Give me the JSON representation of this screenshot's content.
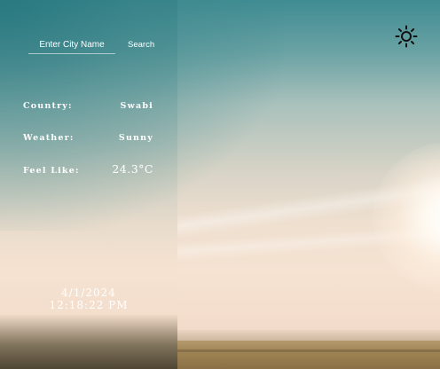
{
  "search": {
    "placeholder": "Enter City Name",
    "value": "",
    "button_label": "Search"
  },
  "info": {
    "country": {
      "label": "Country:",
      "value": "Swabi"
    },
    "weather": {
      "label": "Weather:",
      "value": "Sunny"
    },
    "feel_like": {
      "label": "Feel Like:",
      "value": "24.3°C"
    }
  },
  "clock": {
    "date": "4/1/2024",
    "time": "12:18:22 PM"
  },
  "theme_toggle": {
    "icon": "sun-icon"
  },
  "colors": {
    "text": "#ffffff",
    "panel_teal": "#3f8c92",
    "icon": "#111111"
  }
}
